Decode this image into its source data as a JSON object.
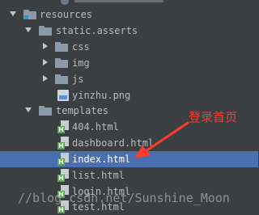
{
  "tree": {
    "resources": "resources",
    "static_asserts": "static.asserts",
    "css": "css",
    "img": "img",
    "js": "js",
    "yinzhu": "yinzhu.png",
    "templates": "templates",
    "files": [
      "404.html",
      "dashboard.html",
      "index.html",
      "list.html",
      "login.html",
      "test.html"
    ],
    "html_badge": "H"
  },
  "annotation": "登录首页",
  "watermark": "//blog.csdn.net/Sunshine_Moon",
  "colors": {
    "background": "#3c3f41",
    "selection": "#4b6eaf",
    "annotation": "#ff3b30",
    "folder": "#8a9aa8",
    "html_badge": "#58a653"
  }
}
